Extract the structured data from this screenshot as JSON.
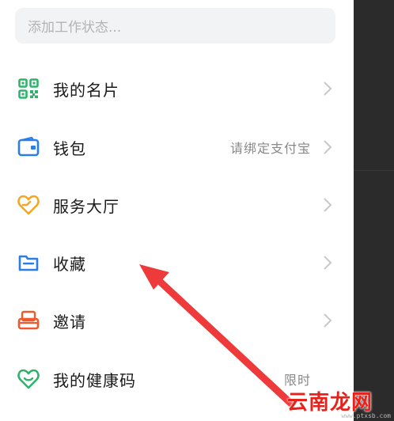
{
  "status_input": {
    "placeholder": "添加工作状态..."
  },
  "menu": {
    "items": [
      {
        "label": "我的名片",
        "sub": "",
        "icon": "qr-code-icon"
      },
      {
        "label": "钱包",
        "sub": "请绑定支付宝",
        "icon": "wallet-icon"
      },
      {
        "label": "服务大厅",
        "sub": "",
        "icon": "heart-hands-icon"
      },
      {
        "label": "收藏",
        "sub": "",
        "icon": "folder-icon"
      },
      {
        "label": "邀请",
        "sub": "",
        "icon": "invite-icon"
      },
      {
        "label": "我的健康码",
        "sub": "限时",
        "icon": "health-heart-icon"
      }
    ]
  },
  "watermark": {
    "logo": "云南龙网",
    "url": "www.ptxsb.com"
  },
  "colors": {
    "green": "#2fb36a",
    "blue": "#2b7de9",
    "orange": "#f5a623",
    "red_orange": "#ef5a2c",
    "arrow": "#ee3a3a",
    "chevron": "#c8c8c8"
  }
}
